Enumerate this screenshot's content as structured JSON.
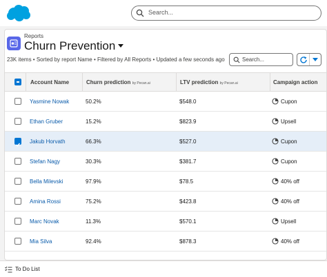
{
  "colors": {
    "brand": "#00a1e0",
    "accent": "#0176d3",
    "report_icon": "#5867e8",
    "selected_row": "#e5eef8"
  },
  "global_search": {
    "placeholder": "Search...",
    "icon": "search-icon"
  },
  "header": {
    "breadcrumb": "Reports",
    "title": "Churn Prevention",
    "meta": "23K items • Sorted by report Name • Filtered by All Reports • Updated a few seconds ago"
  },
  "list_search": {
    "placeholder": "Search..."
  },
  "table": {
    "columns": [
      {
        "label": "Account Name",
        "sub": ""
      },
      {
        "label": "Churn prediction",
        "sub": "by Pecan.ai"
      },
      {
        "label": "LTV prediction",
        "sub": "by Pecan.ai"
      },
      {
        "label": "Campaign action",
        "sub": ""
      }
    ],
    "rows": [
      {
        "name": "Yasmine Nowak",
        "churn": "50.2%",
        "ltv": "$548.0",
        "action": "Cupon",
        "checked": false
      },
      {
        "name": "Ethan Gruber",
        "churn": "15.2%",
        "ltv": "$823.9",
        "action": "Upsell",
        "checked": false
      },
      {
        "name": "Jakub Horvath",
        "churn": "66.3%",
        "ltv": "$527.0",
        "action": "Cupon",
        "checked": true
      },
      {
        "name": "Stefan Nagy",
        "churn": "30.3%",
        "ltv": "$381.7",
        "action": "Cupon",
        "checked": false
      },
      {
        "name": "Bella Milevski",
        "churn": "97.9%",
        "ltv": "$78.5",
        "action": "40% off",
        "checked": false
      },
      {
        "name": "Amina Rossi",
        "churn": "75.2%",
        "ltv": "$423.8",
        "action": "40% off",
        "checked": false
      },
      {
        "name": "Marc Novak",
        "churn": "11.3%",
        "ltv": "$570.1",
        "action": "Upsell",
        "checked": false
      },
      {
        "name": "Mia Silva",
        "churn": "92.4%",
        "ltv": "$878.3",
        "action": "40% off",
        "checked": false
      }
    ]
  },
  "footer": {
    "label": "To Do List",
    "icon": "checklist-icon"
  }
}
